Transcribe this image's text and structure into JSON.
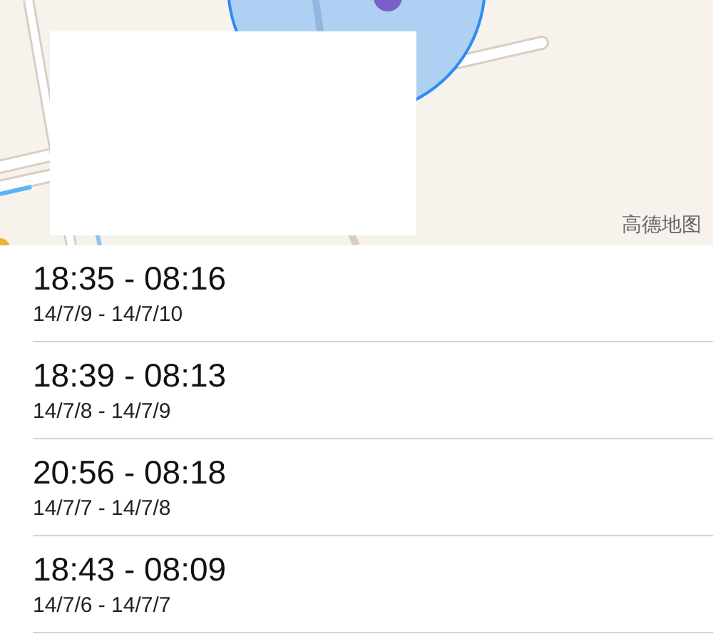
{
  "map": {
    "attribution": "高德地图"
  },
  "sessions": [
    {
      "time_range": "18:35 - 08:16",
      "date_range": "14/7/9 - 14/7/10"
    },
    {
      "time_range": "18:39 - 08:13",
      "date_range": "14/7/8 - 14/7/9"
    },
    {
      "time_range": "20:56 - 08:18",
      "date_range": "14/7/7 - 14/7/8"
    },
    {
      "time_range": "18:43 - 08:09",
      "date_range": "14/7/6 - 14/7/7"
    }
  ]
}
